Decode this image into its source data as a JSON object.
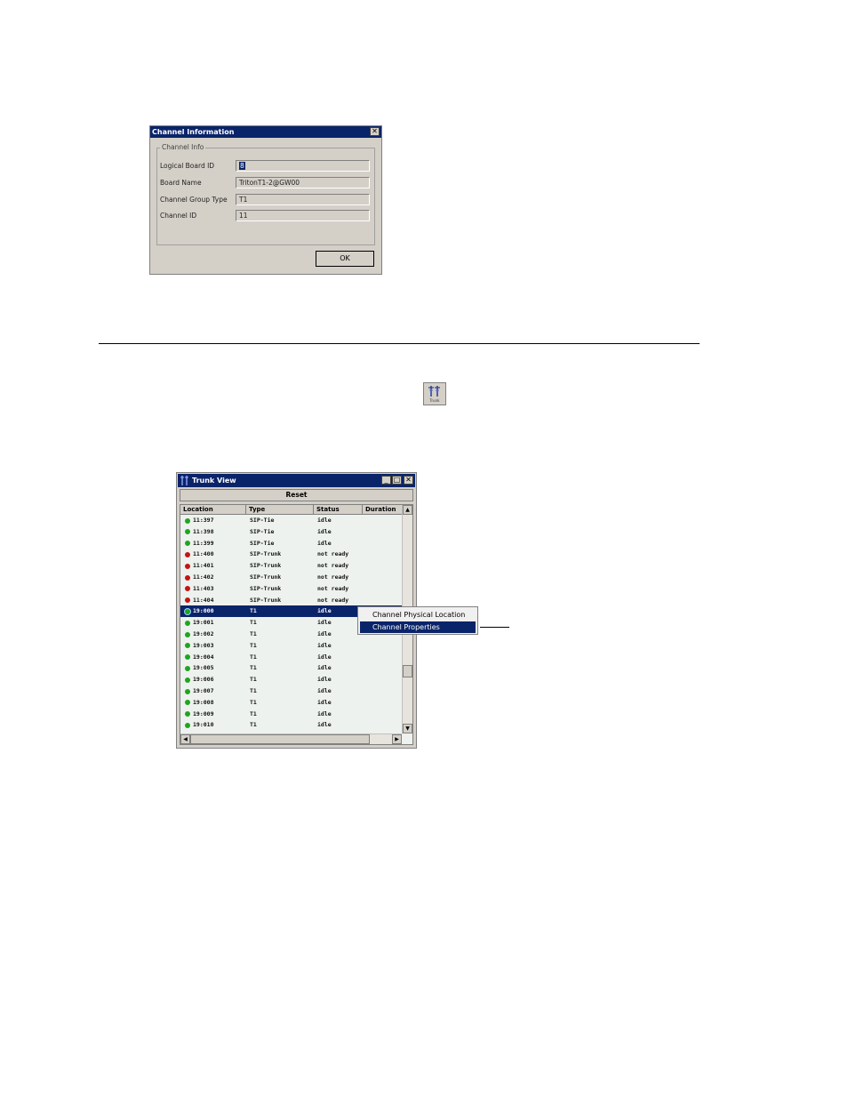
{
  "channel_info_dialog": {
    "title": "Channel Information",
    "close_glyph": "✕",
    "group_label": "Channel Info",
    "fields": [
      {
        "label": "Logical Board ID",
        "value": "8"
      },
      {
        "label": "Board Name",
        "value": "TritonT1-2@GW00"
      },
      {
        "label": "Channel Group Type",
        "value": "T1"
      },
      {
        "label": "Channel ID",
        "value": "11"
      }
    ],
    "ok_label": "OK"
  },
  "toolbar_icon": {
    "icon": "trunk-icon",
    "caption": "Trunk"
  },
  "trunk_view": {
    "title": "Trunk View",
    "reset_label": "Reset",
    "columns": [
      "Location",
      "Type",
      "Status",
      "Duration"
    ],
    "colors": {
      "green": "#1fa51f",
      "red": "#c41414",
      "selected": "#0a246a"
    },
    "rows": [
      {
        "location": "11:397",
        "type": "SIP-Tie",
        "status": "idle",
        "state": "green"
      },
      {
        "location": "11:398",
        "type": "SIP-Tie",
        "status": "idle",
        "state": "green"
      },
      {
        "location": "11:399",
        "type": "SIP-Tie",
        "status": "idle",
        "state": "green"
      },
      {
        "location": "11:400",
        "type": "SIP-Trunk",
        "status": "not ready",
        "state": "red"
      },
      {
        "location": "11:401",
        "type": "SIP-Trunk",
        "status": "not ready",
        "state": "red"
      },
      {
        "location": "11:402",
        "type": "SIP-Trunk",
        "status": "not ready",
        "state": "red"
      },
      {
        "location": "11:403",
        "type": "SIP-Trunk",
        "status": "not ready",
        "state": "red"
      },
      {
        "location": "11:404",
        "type": "SIP-Trunk",
        "status": "not ready",
        "state": "red"
      },
      {
        "location": "19:000",
        "type": "T1",
        "status": "idle",
        "state": "green",
        "selected": true
      },
      {
        "location": "19:001",
        "type": "T1",
        "status": "idle",
        "state": "green"
      },
      {
        "location": "19:002",
        "type": "T1",
        "status": "idle",
        "state": "green"
      },
      {
        "location": "19:003",
        "type": "T1",
        "status": "idle",
        "state": "green"
      },
      {
        "location": "19:004",
        "type": "T1",
        "status": "idle",
        "state": "green"
      },
      {
        "location": "19:005",
        "type": "T1",
        "status": "idle",
        "state": "green"
      },
      {
        "location": "19:006",
        "type": "T1",
        "status": "idle",
        "state": "green"
      },
      {
        "location": "19:007",
        "type": "T1",
        "status": "idle",
        "state": "green"
      },
      {
        "location": "19:008",
        "type": "T1",
        "status": "idle",
        "state": "green"
      },
      {
        "location": "19:009",
        "type": "T1",
        "status": "idle",
        "state": "green"
      },
      {
        "location": "19:010",
        "type": "T1",
        "status": "idle",
        "state": "green"
      }
    ]
  },
  "context_menu": {
    "items": [
      "Channel Physical Location",
      "Channel Properties"
    ],
    "active_index": 1
  }
}
